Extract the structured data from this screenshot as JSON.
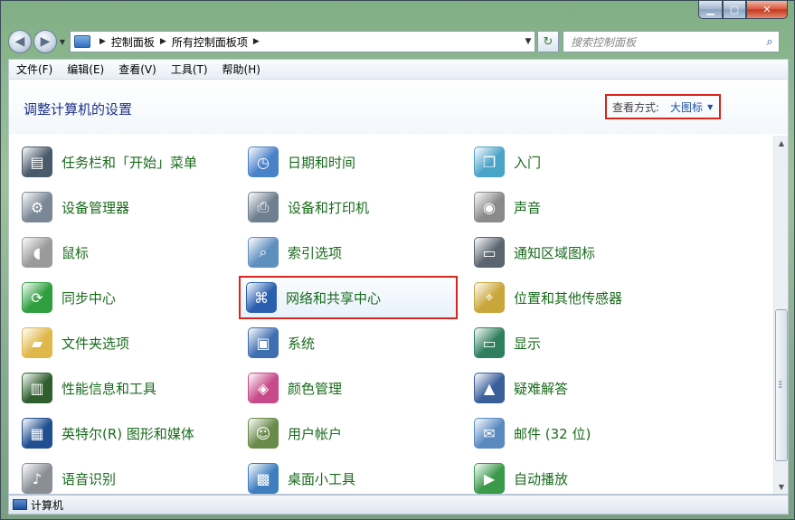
{
  "breadcrumb": {
    "items": [
      "控制面板",
      "所有控制面板项"
    ]
  },
  "search": {
    "placeholder": "搜索控制面板"
  },
  "menu": [
    "文件(F)",
    "编辑(E)",
    "查看(V)",
    "工具(T)",
    "帮助(H)"
  ],
  "content": {
    "title": "调整计算机的设置",
    "view_by_label": "查看方式:",
    "view_by_value": "大图标"
  },
  "items": [
    {
      "label": "任务栏和「开始」菜单",
      "icon": "taskbar-icon",
      "color": "#4a5a6a"
    },
    {
      "label": "日期和时间",
      "icon": "calendar-clock-icon",
      "color": "#4a82c8"
    },
    {
      "label": "入门",
      "icon": "getting-started-icon",
      "color": "#4aa3c8"
    },
    {
      "label": "设备管理器",
      "icon": "device-manager-icon",
      "color": "#7b8794"
    },
    {
      "label": "设备和打印机",
      "icon": "printer-icon",
      "color": "#6f7f8f"
    },
    {
      "label": "声音",
      "icon": "speaker-icon",
      "color": "#8a8a8a"
    },
    {
      "label": "鼠标",
      "icon": "mouse-icon",
      "color": "#9a9a9a"
    },
    {
      "label": "索引选项",
      "icon": "indexing-icon",
      "color": "#5f8fbf"
    },
    {
      "label": "通知区域图标",
      "icon": "notification-area-icon",
      "color": "#5a6570"
    },
    {
      "label": "同步中心",
      "icon": "sync-center-icon",
      "color": "#2f9e3f"
    },
    {
      "label": "网络和共享中心",
      "icon": "network-icon",
      "color": "#2a5fb0"
    },
    {
      "label": "位置和其他传感器",
      "icon": "location-sensor-icon",
      "color": "#c9a63a"
    },
    {
      "label": "文件夹选项",
      "icon": "folder-options-icon",
      "color": "#e0b84a"
    },
    {
      "label": "系统",
      "icon": "system-icon",
      "color": "#3f6fb0"
    },
    {
      "label": "显示",
      "icon": "display-icon",
      "color": "#2f7f5f"
    },
    {
      "label": "性能信息和工具",
      "icon": "performance-icon",
      "color": "#2f5f2f"
    },
    {
      "label": "颜色管理",
      "icon": "color-management-icon",
      "color": "#c84a8a"
    },
    {
      "label": "疑难解答",
      "icon": "troubleshooting-icon",
      "color": "#3a5f9a"
    },
    {
      "label": "英特尔(R) 图形和媒体",
      "icon": "intel-graphics-icon",
      "color": "#1f4f8f"
    },
    {
      "label": "用户帐户",
      "icon": "user-accounts-icon",
      "color": "#6a8a4a"
    },
    {
      "label": "邮件 (32 位)",
      "icon": "mail-icon",
      "color": "#5a8ac0"
    },
    {
      "label": "语音识别",
      "icon": "microphone-icon",
      "color": "#8a8f96"
    },
    {
      "label": "桌面小工具",
      "icon": "gadgets-icon",
      "color": "#3f7fc0"
    },
    {
      "label": "自动播放",
      "icon": "autoplay-icon",
      "color": "#3a9a4a"
    }
  ],
  "status": {
    "text": "计算机"
  }
}
